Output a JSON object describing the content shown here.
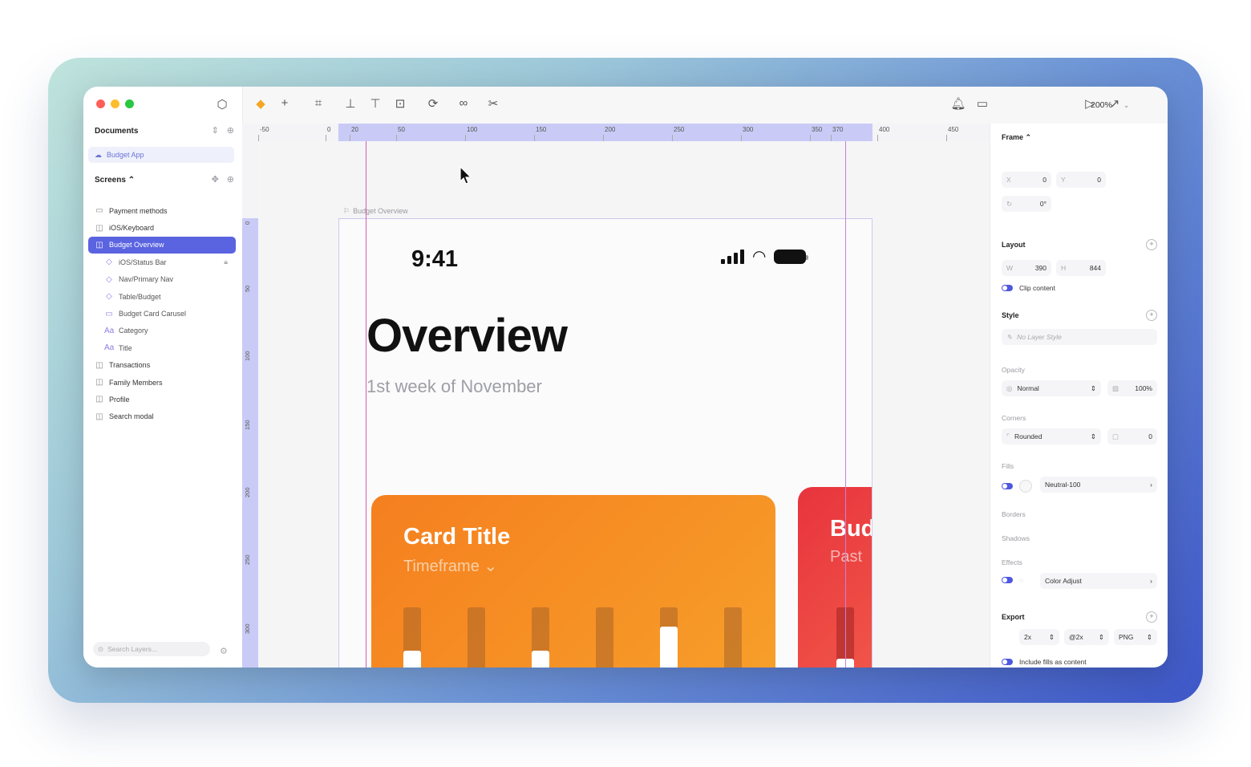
{
  "sidebar": {
    "documents_label": "Documents",
    "document_item": "Budget App",
    "screens_label": "Screens",
    "layers": [
      {
        "label": "Payment methods",
        "icon": "folder-icon",
        "level": 0,
        "selected": false
      },
      {
        "label": "iOS/Keyboard",
        "icon": "symbol-icon",
        "level": 0,
        "selected": false
      },
      {
        "label": "Budget Overview",
        "icon": "artboard-icon",
        "level": 0,
        "selected": true
      },
      {
        "label": "iOS/Status Bar",
        "icon": "component-icon",
        "level": 1,
        "selected": false
      },
      {
        "label": "Nav/Primary Nav",
        "icon": "component-icon",
        "level": 1,
        "selected": false
      },
      {
        "label": "Table/Budget",
        "icon": "component-icon",
        "level": 1,
        "selected": false
      },
      {
        "label": "Budget Card Carusel",
        "icon": "folder-icon",
        "level": 1,
        "selected": false
      },
      {
        "label": "Category",
        "icon": "text-icon",
        "level": 1,
        "selected": false
      },
      {
        "label": "Title",
        "icon": "text-icon",
        "level": 1,
        "selected": false
      },
      {
        "label": "Transactions",
        "icon": "artboard-icon",
        "level": 0,
        "selected": false
      },
      {
        "label": "Family Members",
        "icon": "artboard-icon",
        "level": 0,
        "selected": false
      },
      {
        "label": "Profile",
        "icon": "artboard-icon",
        "level": 0,
        "selected": false
      },
      {
        "label": "Search modal",
        "icon": "artboard-icon",
        "level": 0,
        "selected": false
      }
    ],
    "search_placeholder": "Search Layers..."
  },
  "toolbar": {
    "zoom": "200%"
  },
  "ruler": {
    "h_ticks": [
      "-50",
      "0",
      "20",
      "50",
      "100",
      "150",
      "200",
      "250",
      "300",
      "350",
      "370",
      "400",
      "450"
    ],
    "v_ticks": [
      "0",
      "50",
      "100",
      "150",
      "200",
      "250",
      "300"
    ]
  },
  "canvas": {
    "frame_label": "Budget Overview",
    "status_time": "9:41",
    "title": "Overview",
    "subtitle": "1st week of November",
    "card1": {
      "title": "Card Title",
      "timeframe": "Timeframe ⌄",
      "bar_levels": [
        0.55,
        0.2,
        0.55,
        0.0,
        0.8,
        0.2
      ]
    },
    "card2": {
      "title": "Bud",
      "timeframe": "Past"
    }
  },
  "inspector": {
    "frame_label": "Frame",
    "x_label": "X",
    "x_value": "0",
    "y_label": "Y",
    "y_value": "0",
    "rotation_value": "0°",
    "layout_label": "Layout",
    "w_label": "W",
    "w_value": "390",
    "h_label": "H",
    "h_value": "844",
    "clip_content": "Clip content",
    "style_label": "Style",
    "layer_style_placeholder": "No Layer Style",
    "opacity_label": "Opacity",
    "blend_mode": "Normal",
    "opacity_value": "100%",
    "corners_label": "Corners",
    "corner_style": "Rounded",
    "corner_value": "0",
    "fills_label": "Fills",
    "fill_name": "Neutral-100",
    "borders_label": "Borders",
    "shadows_label": "Shadows",
    "effects_label": "Effects",
    "effect_name": "Color Adjust",
    "export_label": "Export",
    "export_scale": "2x",
    "export_suffix": "@2x",
    "export_format": "PNG",
    "include_fills": "Include fills as content"
  },
  "colors": {
    "accent": "#5a63e0",
    "card1": "#f57f1f",
    "card2": "#e8343d"
  }
}
